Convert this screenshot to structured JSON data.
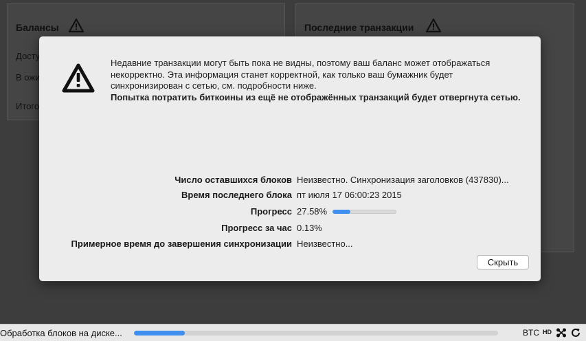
{
  "background": {
    "balances_title": "Балансы",
    "balances_lines": [
      "Досту",
      "В ожи",
      "Итого"
    ],
    "transactions_title": "Последние транзакции"
  },
  "modal": {
    "message": "Недавние транзакции могут быть пока не видны, поэтому ваш баланс может отображаться некорректно. Эта информация станет корректной, как только ваш бумажник будет синхронизирован с сетью, см. подробности ниже.",
    "warning_bold": "Попытка потратить биткоины из ещё не отображённых транзакций будет отвергнута сетью.",
    "rows": {
      "blocks_left_label": "Число оставшихся блоков",
      "blocks_left_value": "Неизвестно. Синхронизация заголовков (437830)...",
      "last_block_time_label": "Время последнего блока",
      "last_block_time_value": "пт июля 17 06:00:23 2015",
      "progress_label": "Прогресс",
      "progress_value": "27.58%",
      "progress_fraction": 0.2758,
      "progress_per_hour_label": "Прогресс за час",
      "progress_per_hour_value": "0.13%",
      "eta_label": "Примерное время до завершения синхронизации",
      "eta_value": "Неизвестно..."
    },
    "hide_button": "Скрыть"
  },
  "statusbar": {
    "text": "Обработка блоков на диске...",
    "progress_fraction": 0.14,
    "unit": "BTC",
    "hd_label": "HD"
  },
  "colors": {
    "accent": "#3e8ff0",
    "modal_bg": "#ececec",
    "backdrop": "#3d3d3d"
  },
  "icons": [
    "warning-icon",
    "network-icon",
    "sync-icon"
  ]
}
